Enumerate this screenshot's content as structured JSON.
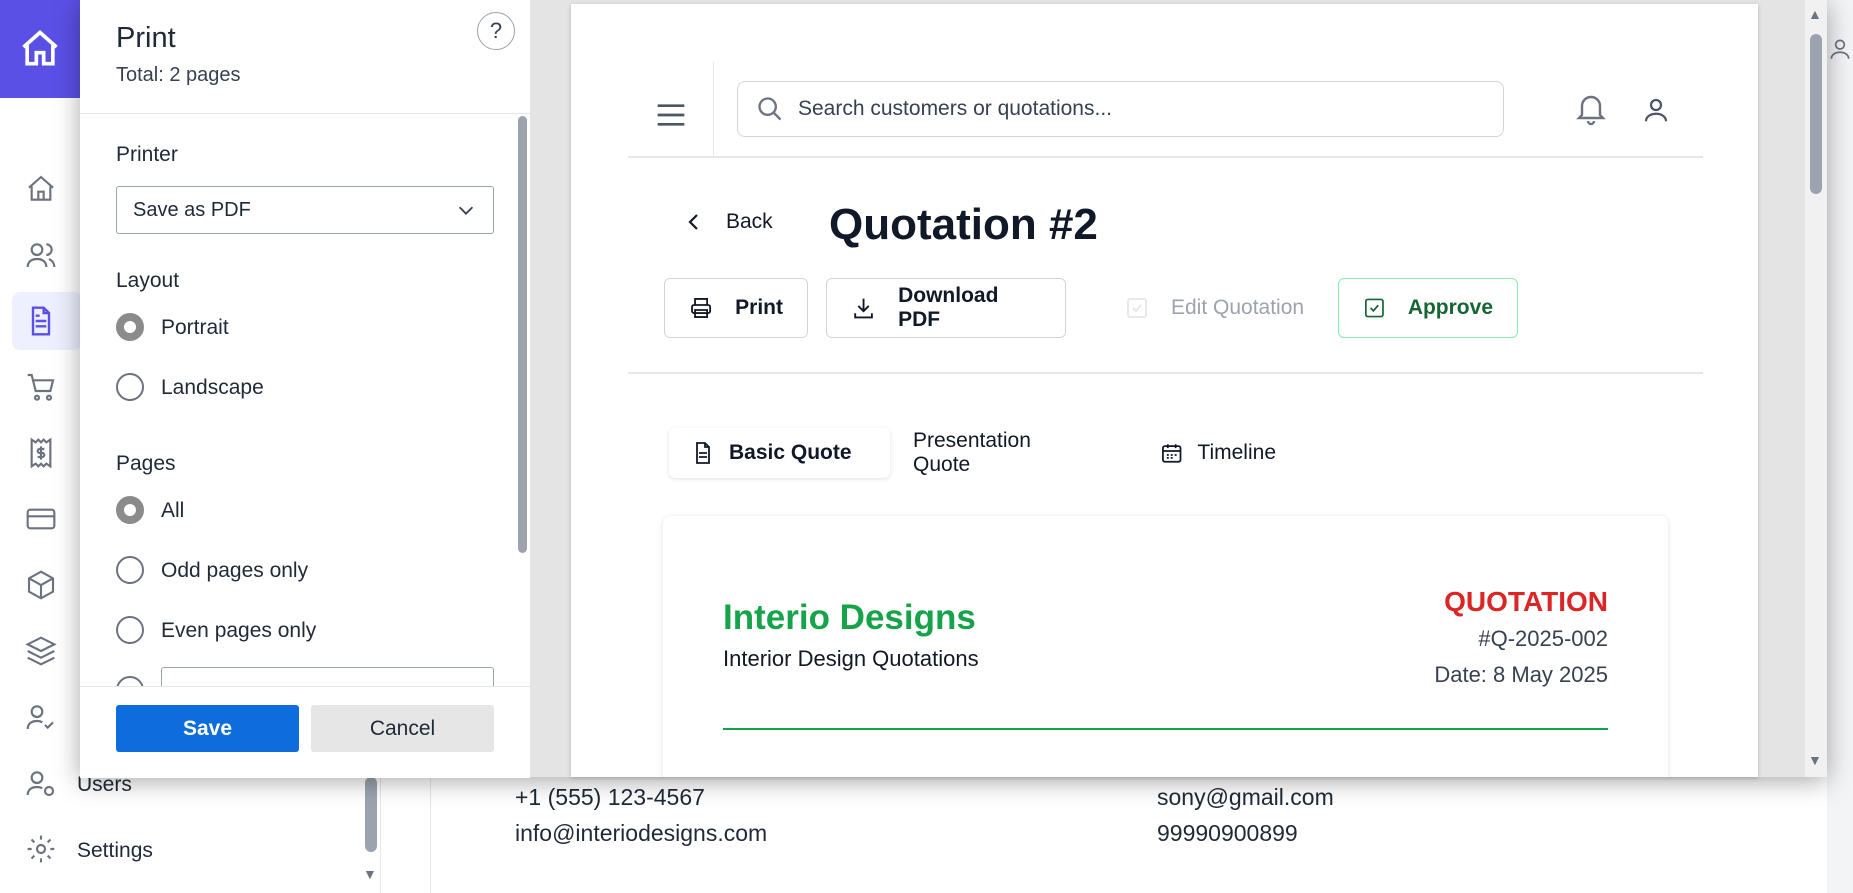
{
  "background": {
    "sidebar": {
      "items": [
        {
          "icon": "home-icon",
          "label": ""
        },
        {
          "icon": "users-icon",
          "label": ""
        },
        {
          "icon": "file-text-icon",
          "label": ""
        },
        {
          "icon": "cart-icon",
          "label": ""
        },
        {
          "icon": "receipt-icon",
          "label": ""
        },
        {
          "icon": "credit-card-icon",
          "label": ""
        },
        {
          "icon": "box-icon",
          "label": ""
        },
        {
          "icon": "layers-icon",
          "label": ""
        },
        {
          "icon": "user-check-icon",
          "label": ""
        },
        {
          "icon": "users-gear-icon",
          "label": "Users"
        },
        {
          "icon": "settings-icon",
          "label": "Settings"
        }
      ]
    },
    "contact_left": {
      "phone": "+1 (555) 123-4567",
      "email": "info@interiodesigns.com"
    },
    "contact_right": {
      "email": "sony@gmail.com",
      "phone": "99990900899"
    }
  },
  "print_dialog": {
    "title": "Print",
    "subtitle": "Total: 2 pages",
    "help": "?",
    "printer_label": "Printer",
    "printer_value": "Save as PDF",
    "layout_label": "Layout",
    "layout_options": [
      "Portrait",
      "Landscape"
    ],
    "layout_selected": "Portrait",
    "pages_label": "Pages",
    "pages_options": [
      "All",
      "Odd pages only",
      "Even pages only"
    ],
    "pages_selected": "All",
    "save_label": "Save",
    "cancel_label": "Cancel"
  },
  "preview": {
    "search_placeholder": "Search customers or quotations...",
    "back_label": "Back",
    "title": "Quotation #2",
    "actions": {
      "print": "Print",
      "download": "Download PDF",
      "edit": "Edit Quotation",
      "approve": "Approve"
    },
    "tabs": [
      "Basic Quote",
      "Presentation Quote",
      "Timeline"
    ],
    "card": {
      "company": "Interio Designs",
      "company_sub": "Interior Design Quotations",
      "doc_type": "QUOTATION",
      "number": "#Q-2025-002",
      "date": "Date: 8 May 2025"
    }
  },
  "colors": {
    "brand": "#5b50e6",
    "primary_button": "#0f6cdc",
    "company_green": "#16a34a",
    "quotation_red": "#dc2626"
  }
}
